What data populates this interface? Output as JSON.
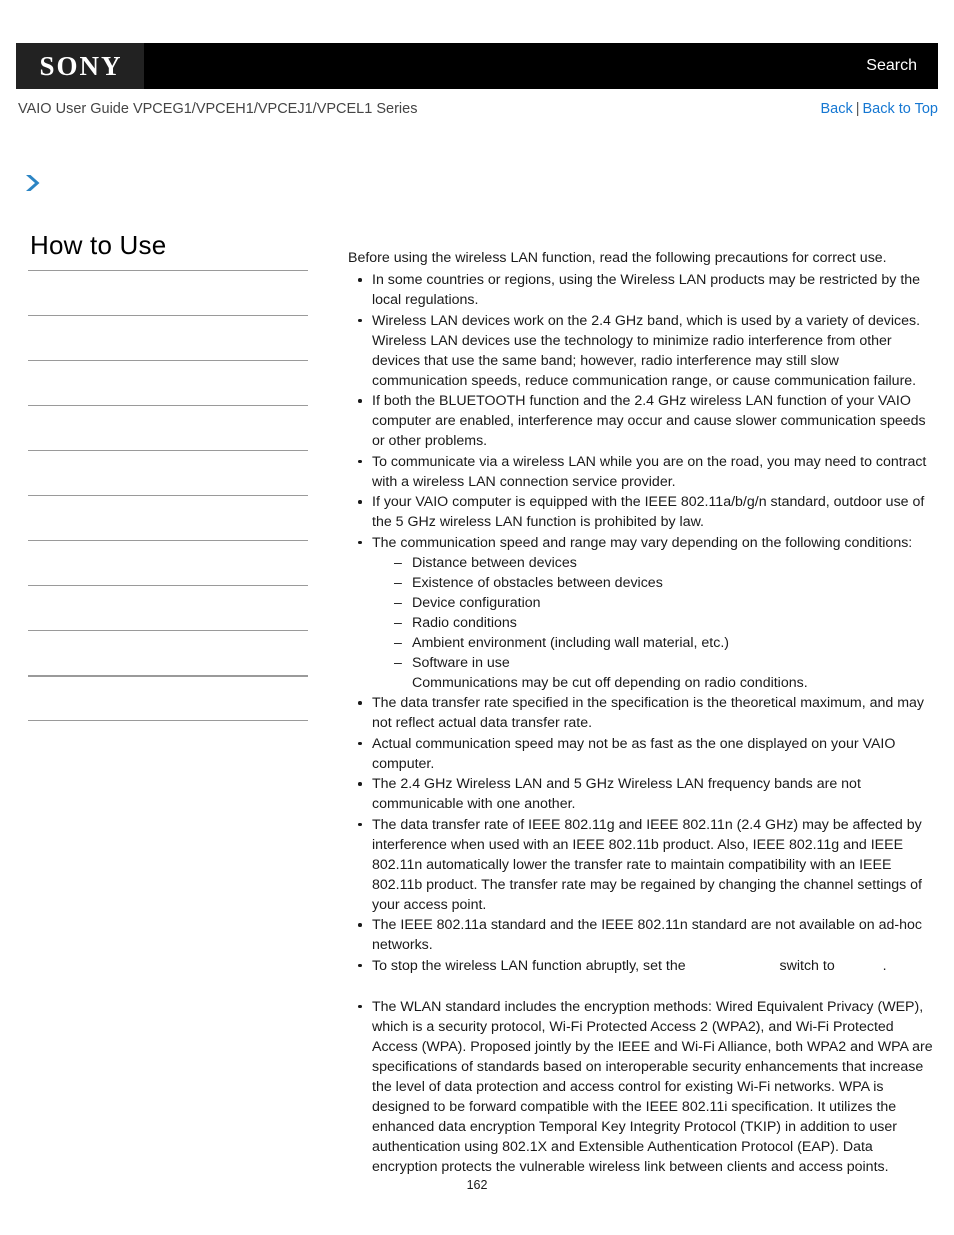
{
  "header": {
    "logo_text": "SONY",
    "search_label": "Search",
    "guide_title": "VAIO User Guide VPCEG1/VPCEH1/VPCEJ1/VPCEL1 Series",
    "back_label": "Back",
    "nav_separator": "|",
    "back_to_top_label": "Back to Top",
    "link_color": "#1577d2",
    "bar_color": "#000000"
  },
  "sidebar": {
    "heading": "How to Use",
    "items": [
      {
        "label": ""
      },
      {
        "label": ""
      },
      {
        "label": ""
      },
      {
        "label": ""
      },
      {
        "label": ""
      },
      {
        "label": ""
      },
      {
        "label": ""
      },
      {
        "label": ""
      },
      {
        "label": ""
      },
      {
        "label": ""
      },
      {
        "label": ""
      }
    ]
  },
  "content": {
    "lead": "Before using the wireless LAN function, read the following precautions for correct use.",
    "bullets": [
      "In some countries or regions, using the Wireless LAN products may be restricted by the local regulations.",
      "Wireless LAN devices work on the 2.4 GHz band, which is used by a variety of devices. Wireless LAN devices use the technology to minimize radio interference from other devices that use the same band; however, radio interference may still slow communication speeds, reduce communication range, or cause communication failure.",
      "If both the BLUETOOTH function and the 2.4 GHz wireless LAN function of your VAIO computer are enabled, interference may occur and cause slower communication speeds or other problems.",
      "To communicate via a wireless LAN while you are on the road, you may need to contract with a wireless LAN connection service provider.",
      "If your VAIO computer is equipped with the IEEE 802.11a/b/g/n standard, outdoor use of the 5 GHz wireless LAN function is prohibited by law.",
      "The communication speed and range may vary depending on the following conditions:"
    ],
    "sublist": [
      "Distance between devices",
      "Existence of obstacles between devices",
      "Device configuration",
      "Radio conditions",
      "Ambient environment (including wall material, etc.)",
      "Software in use"
    ],
    "sublist_note": "Communications may be cut off depending on radio conditions.",
    "bullets_after": [
      "The data transfer rate specified in the specification is the theoretical maximum, and may not reflect actual data transfer rate.",
      "Actual communication speed may not be as fast as the one displayed on your VAIO computer.",
      "The 2.4 GHz Wireless LAN and 5 GHz Wireless LAN frequency bands are not communicable with one another.",
      "The data transfer rate of IEEE 802.11g and IEEE 802.11n (2.4 GHz) may be affected by interference when used with an IEEE 802.11b product. Also, IEEE 802.11g and IEEE 802.11n automatically lower the transfer rate to maintain compatibility with an IEEE 802.11b product. The transfer rate may be regained by changing the channel settings of your access point.",
      "The IEEE 802.11a standard and the IEEE 802.11n standard are not available on ad-hoc networks."
    ],
    "switch_bullet": {
      "text_before": "To stop the wireless LAN function abruptly, set the",
      "text_middle": "switch to",
      "text_after": "."
    },
    "final_bullet": "The WLAN standard includes the encryption methods: Wired Equivalent Privacy (WEP), which is a security protocol, Wi-Fi Protected Access 2 (WPA2), and Wi-Fi Protected Access (WPA). Proposed jointly by the IEEE and Wi-Fi Alliance, both WPA2 and WPA are specifications of standards based on interoperable security enhancements that increase the level of data protection and access control for existing Wi-Fi networks. WPA is designed to be forward compatible with the IEEE 802.11i specification. It utilizes the enhanced data encryption Temporal Key Integrity Protocol (TKIP) in addition to user authentication using 802.1X and Extensible Authentication Protocol (EAP). Data encryption protects the vulnerable wireless link between clients and access points."
  },
  "footer": {
    "page_number": "162"
  }
}
